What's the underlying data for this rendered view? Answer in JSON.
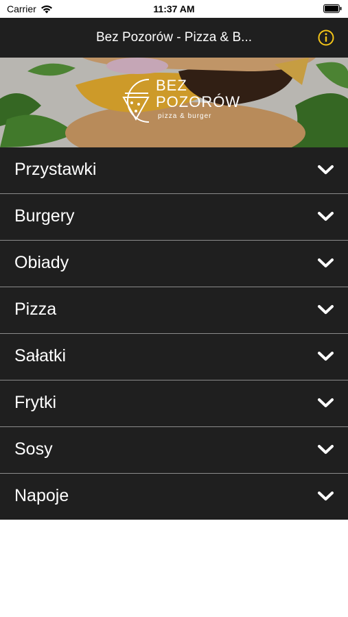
{
  "status_bar": {
    "carrier": "Carrier",
    "time": "11:37 AM"
  },
  "nav": {
    "title": "Bez Pozorów - Pizza & B...",
    "info_icon": "info-circle-icon",
    "accent_color": "#f5c518"
  },
  "banner": {
    "logo_line1": "BEZ",
    "logo_line2": "POZORÓW",
    "logo_sub": "pizza & burger"
  },
  "menu": {
    "items": [
      {
        "label": "Przystawki"
      },
      {
        "label": "Burgery"
      },
      {
        "label": "Obiady"
      },
      {
        "label": "Pizza"
      },
      {
        "label": "Sałatki"
      },
      {
        "label": "Frytki"
      },
      {
        "label": "Sosy"
      },
      {
        "label": "Napoje"
      }
    ],
    "chevron_icon": "chevron-down-icon"
  },
  "colors": {
    "bar_background": "#1f1f1f",
    "separator": "#8c8c8c",
    "text": "#ffffff"
  }
}
